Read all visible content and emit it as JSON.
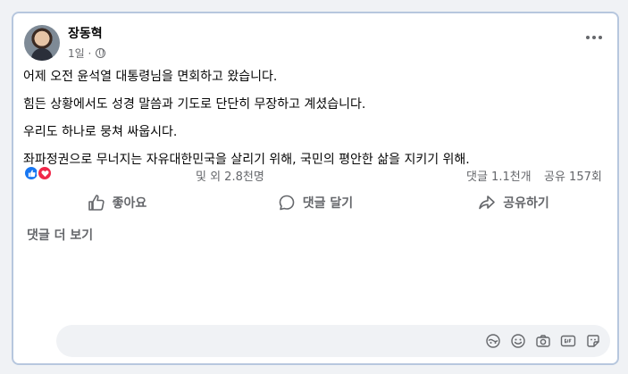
{
  "post": {
    "author": "장동혁",
    "time": "1일 ·",
    "privacy_icon": "globe-icon",
    "lines": [
      "어제 오전 윤석열 대통령님을 면회하고 왔습니다.",
      "힘든 상황에서도 성경 말씀과 기도로 단단히 무장하고 계셨습니다.",
      "우리도 하나로 뭉쳐 싸웁시다.",
      "좌파정권으로 무너지는 자유대한민국을 살리기 위해, 국민의 평안한 삶을 지키기 위해."
    ]
  },
  "stats": {
    "reactions": [
      "like-icon",
      "love-icon"
    ],
    "reaction_count": "및 외 2.8천명",
    "comment_count": "댓글 1.1천개",
    "share_count": "공유 157회"
  },
  "actions": {
    "like": "좋아요",
    "comment": "댓글 달기",
    "share": "공유하기"
  },
  "more_comments": "댓글 더 보기",
  "composer": {
    "placeholder": "",
    "icons": [
      "avatar-sticker-icon",
      "emoji-icon",
      "camera-icon",
      "gif-icon",
      "sticker-icon"
    ]
  },
  "colors": {
    "card_border": "#b7c7de",
    "like_blue": "#1877f2",
    "love_red": "#f0284a",
    "secondary_text": "#65676b"
  }
}
